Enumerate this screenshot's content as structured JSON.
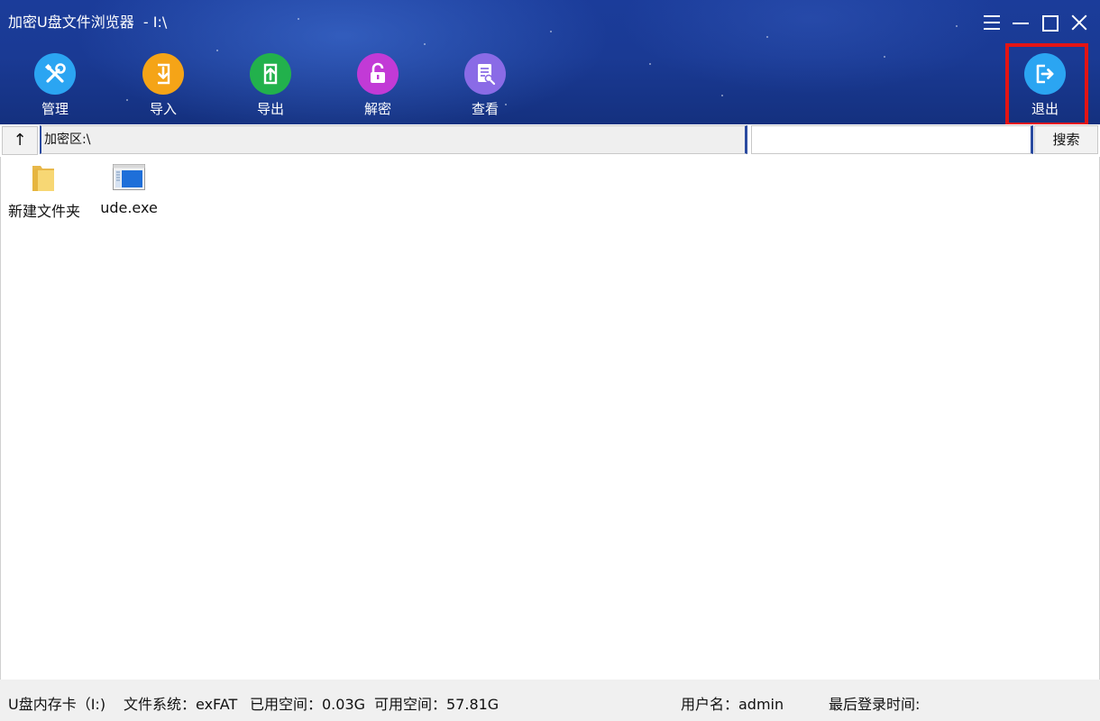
{
  "window": {
    "title": "加密U盘文件浏览器  - I:\\"
  },
  "toolbar": {
    "items": [
      {
        "label": "管理",
        "icon": "wrench-screwdriver-icon",
        "color": "#2ba5f2"
      },
      {
        "label": "导入",
        "icon": "import-icon",
        "color": "#f5a417"
      },
      {
        "label": "导出",
        "icon": "export-icon",
        "color": "#22b14c"
      },
      {
        "label": "解密",
        "icon": "unlock-icon",
        "color": "#c23ad6"
      },
      {
        "label": "查看",
        "icon": "view-document-icon",
        "color": "#8a6be6"
      }
    ],
    "exit": {
      "label": "退出",
      "icon": "exit-icon",
      "color": "#2ba5f2"
    }
  },
  "addressbar": {
    "up_label": "↑",
    "path": "加密区:\\",
    "search_value": "",
    "search_button": "搜索"
  },
  "files": [
    {
      "name": "新建文件夹",
      "icon": "folder-icon"
    },
    {
      "name": "ude.exe",
      "icon": "exe-icon"
    }
  ],
  "status": {
    "drive": "U盘内存卡（I:)",
    "filesystem": "文件系统：exFAT",
    "used": "已用空间：0.03G",
    "free": "可用空间：57.81G",
    "user": "用户名：admin",
    "last_login": "最后登录时间:"
  },
  "colors": {
    "header_bg": "#1a3a94",
    "highlight_border": "#e31414",
    "accent_border": "#2a4aa0",
    "statusbar_bg": "#f0f0f0"
  }
}
